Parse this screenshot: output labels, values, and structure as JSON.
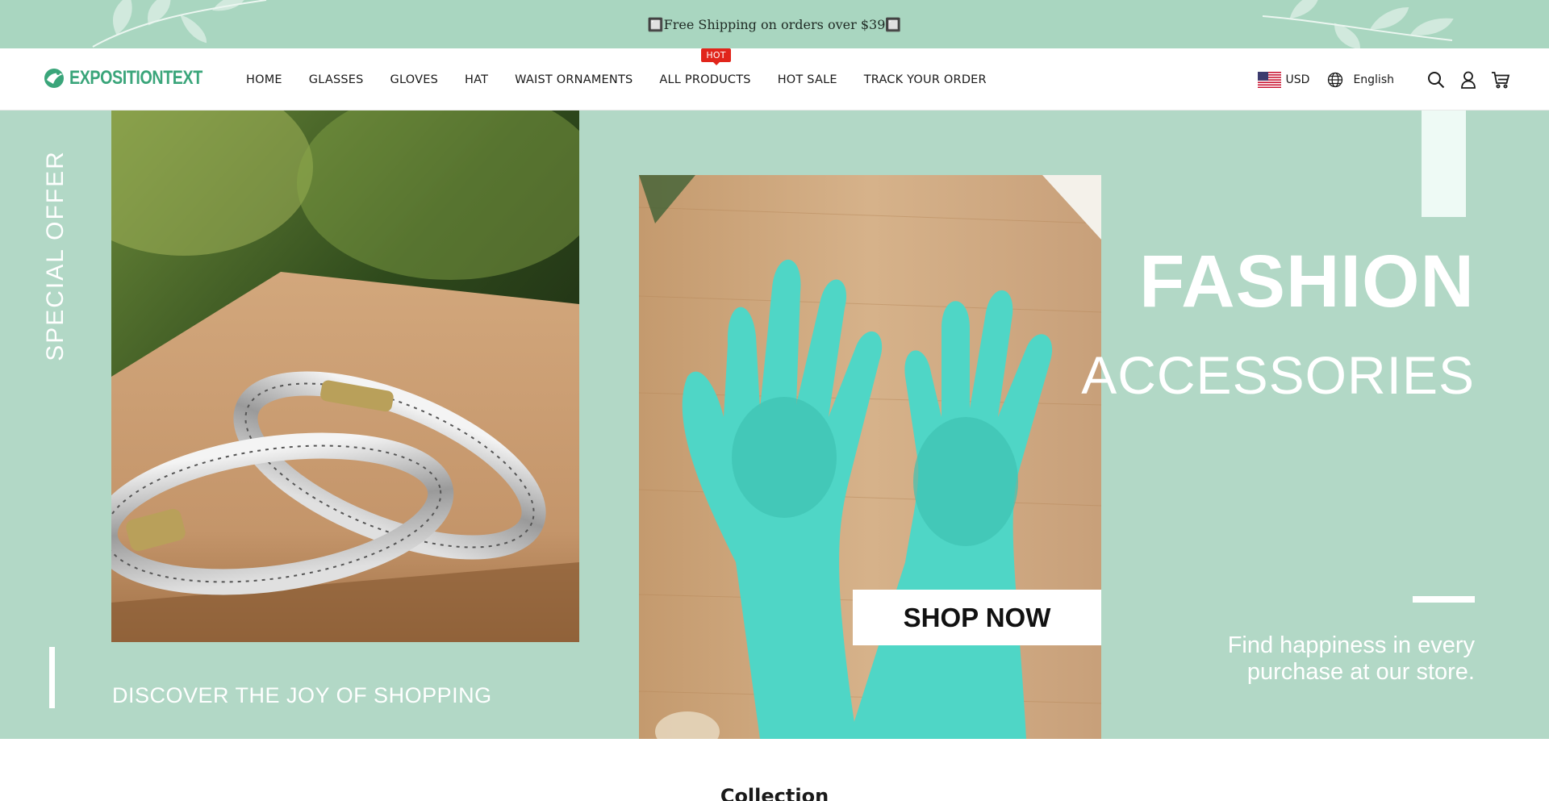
{
  "announcement": {
    "text": "🔲Free Shipping on orders over $39🔲"
  },
  "brand": {
    "name": "EXPOSITIONTEXT",
    "color": "#3aa57a"
  },
  "nav": {
    "items": [
      {
        "label": "HOME"
      },
      {
        "label": "GLASSES"
      },
      {
        "label": "GLOVES"
      },
      {
        "label": "HAT"
      },
      {
        "label": "WAIST ORNAMENTS"
      },
      {
        "label": "ALL PRODUCTS",
        "badge": "HOT"
      },
      {
        "label": "HOT SALE"
      },
      {
        "label": "TRACK YOUR ORDER"
      }
    ]
  },
  "tools": {
    "currency": "USD",
    "currency_flag_icon": "us-flag-icon",
    "language": "English",
    "icons": [
      "globe-icon",
      "search-icon",
      "account-icon",
      "cart-icon"
    ]
  },
  "hero": {
    "special_offer": "SPECIAL OFFER",
    "discover": "DISCOVER THE JOY OF SHOPPING",
    "headline": "FASHION",
    "subheadline": "ACCESSORIES",
    "cta": "SHOP NOW",
    "tagline": "Find happiness in every purchase at our store.",
    "background_color": "#b2d8c6",
    "product_left": "silver-feather-bracelets-photo",
    "product_right": "teal-silicone-gloves-photo"
  },
  "collection": {
    "title": "Collection"
  },
  "colors": {
    "announcement_bg": "#a9d6c0",
    "hot_badge": "#e1251b",
    "glove_teal": "#4fd6c6"
  }
}
